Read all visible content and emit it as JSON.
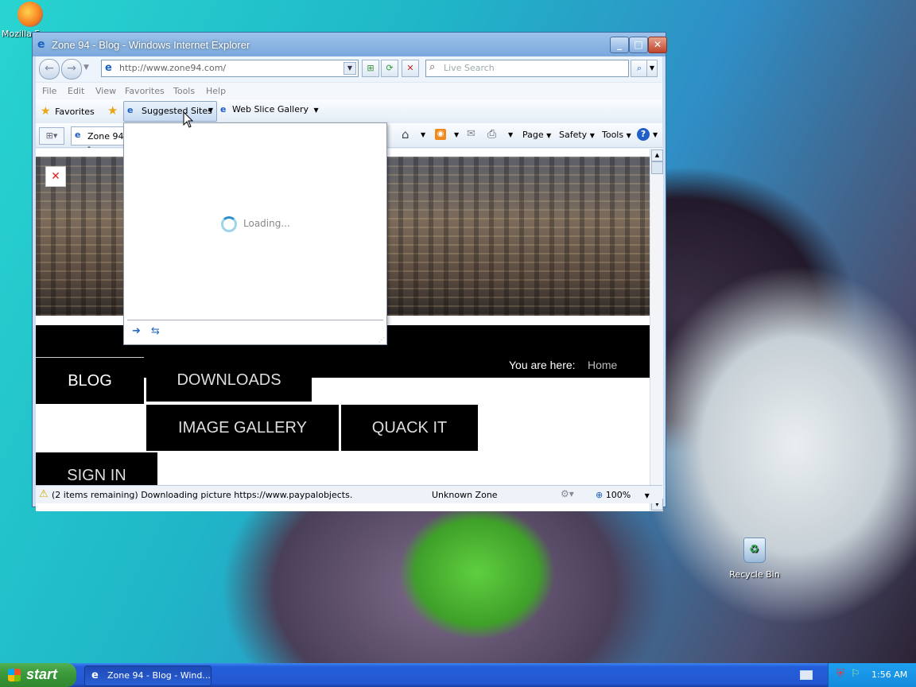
{
  "desktop": {
    "firefox_label": "Mozilla F",
    "recycle_label": "Recycle Bin"
  },
  "window": {
    "title": "Zone 94 - Blog - Windows Internet Explorer",
    "address": "http://www.zone94.com/",
    "search_placeholder": "Live Search",
    "menu": [
      "File",
      "Edit",
      "View",
      "Favorites",
      "Tools",
      "Help"
    ],
    "favorites_label": "Favorites",
    "suggested_label": "Suggested Sites",
    "webslice_label": "Web Slice Gallery",
    "tab_label": "Zone 94 -",
    "commands": {
      "page": "Page",
      "safety": "Safety",
      "tools": "Tools"
    },
    "status_text": "(2 items remaining) Downloading picture https://www.paypalobjects.",
    "zone_text": "Unknown Zone",
    "zoom_text": "100%"
  },
  "dropdown": {
    "loading_text": "Loading..."
  },
  "site": {
    "breadcrumb_label": "You are here:",
    "breadcrumb_home": "Home",
    "nav": [
      "BLOG",
      "DOWNLOADS",
      "IMAGE GALLERY",
      "QUACK IT",
      "SIGN IN"
    ]
  },
  "taskbar": {
    "start_label": "start",
    "task_label": "Zone 94 - Blog - Wind...",
    "clock": "1:56 AM"
  }
}
